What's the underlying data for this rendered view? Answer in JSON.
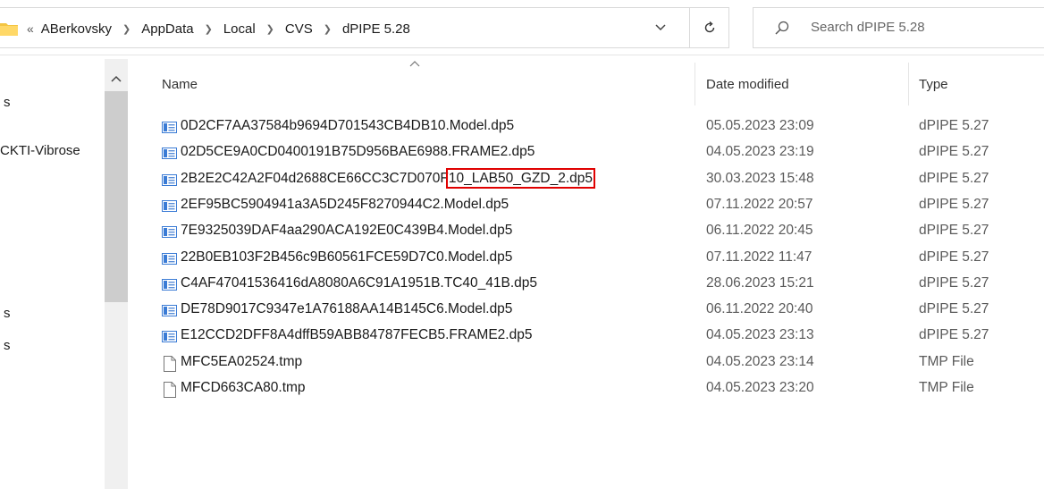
{
  "address_bar": {
    "overflow": "«",
    "crumbs": [
      "ABerkovsky",
      "AppData",
      "Local",
      "CVS",
      "dPIPE 5.28"
    ]
  },
  "search": {
    "placeholder": "Search dPIPE 5.28"
  },
  "nav_pane": {
    "items": [
      {
        "label": "s"
      },
      {
        "label": "CKTI-Vibrose"
      },
      {
        "label": "s"
      },
      {
        "label": "s"
      }
    ]
  },
  "columns": {
    "name": "Name",
    "date": "Date modified",
    "type": "Type"
  },
  "files": [
    {
      "name": "0D2CF7AA37584b9694D701543CB4DB10.Model.dp5",
      "date": "05.05.2023 23:09",
      "type": "dPIPE 5.27",
      "icon": "dpipe-file-icon"
    },
    {
      "name": "02D5CE9A0CD0400191B75D956BAE6988.FRAME2.dp5",
      "date": "04.05.2023 23:19",
      "type": "dPIPE 5.27",
      "icon": "dpipe-file-icon"
    },
    {
      "name_prefix": "2B2E2C42A2F04d2688CE66CC3C7D070F",
      "name_highlight": "10_LAB50_GZD_2.dp5",
      "date": "30.03.2023 15:48",
      "type": "dPIPE 5.27",
      "icon": "dpipe-file-icon"
    },
    {
      "name": "2EF95BC5904941a3A5D245F8270944C2.Model.dp5",
      "date": "07.11.2022 20:57",
      "type": "dPIPE 5.27",
      "icon": "dpipe-file-icon"
    },
    {
      "name": "7E9325039DAF4aa290ACA192E0C439B4.Model.dp5",
      "date": "06.11.2022 20:45",
      "type": "dPIPE 5.27",
      "icon": "dpipe-file-icon"
    },
    {
      "name": "22B0EB103F2B456c9B60561FCE59D7C0.Model.dp5",
      "date": "07.11.2022 11:47",
      "type": "dPIPE 5.27",
      "icon": "dpipe-file-icon"
    },
    {
      "name": "C4AF47041536416dA8080A6C91A1951B.TC40_41B.dp5",
      "date": "28.06.2023 15:21",
      "type": "dPIPE 5.27",
      "icon": "dpipe-file-icon"
    },
    {
      "name": "DE78D9017C9347e1A76188AA14B145C6.Model.dp5",
      "date": "06.11.2022 20:40",
      "type": "dPIPE 5.27",
      "icon": "dpipe-file-icon"
    },
    {
      "name": "E12CCD2DFF8A4dffB59ABB84787FECB5.FRAME2.dp5",
      "date": "04.05.2023 23:13",
      "type": "dPIPE 5.27",
      "icon": "dpipe-file-icon"
    },
    {
      "name": "MFC5EA02524.tmp",
      "date": "04.05.2023 23:14",
      "type": "TMP File",
      "icon": "blank-file-icon"
    },
    {
      "name": "MFCD663CA80.tmp",
      "date": "04.05.2023 23:20",
      "type": "TMP File",
      "icon": "blank-file-icon"
    }
  ],
  "colors": {
    "highlight": "#e00000",
    "scroll_thumb": "#cdcdcd",
    "folder": "#f4c542"
  }
}
